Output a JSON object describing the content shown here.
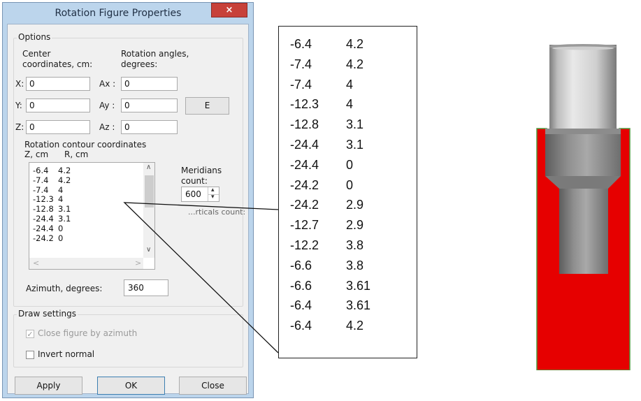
{
  "dialog": {
    "title": "Rotation Figure Properties",
    "close_glyph": "×",
    "options": {
      "legend": "Options",
      "center_label_1": "Center",
      "center_label_2": "coordinates, cm:",
      "rot_label_1": "Rotation angles,",
      "rot_label_2": "degrees:",
      "x_label": "X:",
      "x_value": "0",
      "y_label": "Y:",
      "y_value": "0",
      "z_label": "Z:",
      "z_value": "0",
      "ax_label": "Ax :",
      "ax_value": "0",
      "ay_label": "Ay :",
      "ay_value": "0",
      "az_label": "Az :",
      "az_value": "0",
      "e_button": "E",
      "contour_label": "Rotation contour coordinates",
      "z_col": "Z, cm",
      "r_col": "R, cm",
      "list_rows": [
        {
          "z": "-6.4",
          "r": "4.2"
        },
        {
          "z": "-7.4",
          "r": "4.2"
        },
        {
          "z": "-7.4",
          "r": "4"
        },
        {
          "z": "-12.3",
          "r": "4"
        },
        {
          "z": "-12.8",
          "r": "3.1"
        },
        {
          "z": "-24.4",
          "r": "3.1"
        },
        {
          "z": "-24.4",
          "r": "0"
        },
        {
          "z": "-24.2",
          "r": "0"
        }
      ],
      "meridians_label_1": "Meridians",
      "meridians_label_2": "count:",
      "meridians_value": "600",
      "partial_label": "...rticals count:",
      "azimuth_label": "Azimuth, degrees:",
      "azimuth_value": "360"
    },
    "draw": {
      "legend": "Draw settings",
      "close_azimuth": "Close figure by azimuth",
      "close_azimuth_checked": true,
      "invert_normal": "Invert normal",
      "invert_normal_checked": false
    },
    "buttons": {
      "apply": "Apply",
      "ok": "OK",
      "close": "Close"
    }
  },
  "callout": {
    "rows": [
      {
        "z": "-6.4",
        "r": "4.2"
      },
      {
        "z": "-7.4",
        "r": "4.2"
      },
      {
        "z": "-7.4",
        "r": "4"
      },
      {
        "z": "-12.3",
        "r": "4"
      },
      {
        "z": "-12.8",
        "r": "3.1"
      },
      {
        "z": "-24.4",
        "r": "3.1"
      },
      {
        "z": "-24.4",
        "r": "0"
      },
      {
        "z": "-24.2",
        "r": "0"
      },
      {
        "z": "-24.2",
        "r": "2.9"
      },
      {
        "z": "-12.7",
        "r": "2.9"
      },
      {
        "z": "-12.2",
        "r": "3.8"
      },
      {
        "z": "-6.6",
        "r": "3.8"
      },
      {
        "z": "-6.6",
        "r": "3.61"
      },
      {
        "z": "-6.4",
        "r": "3.61"
      },
      {
        "z": "-6.4",
        "r": "4.2"
      }
    ]
  },
  "colors": {
    "red": "#e60000",
    "green": "#4e9a3d",
    "gray_light": "#d9d9d9",
    "gray_dark": "#8a8a8a"
  }
}
